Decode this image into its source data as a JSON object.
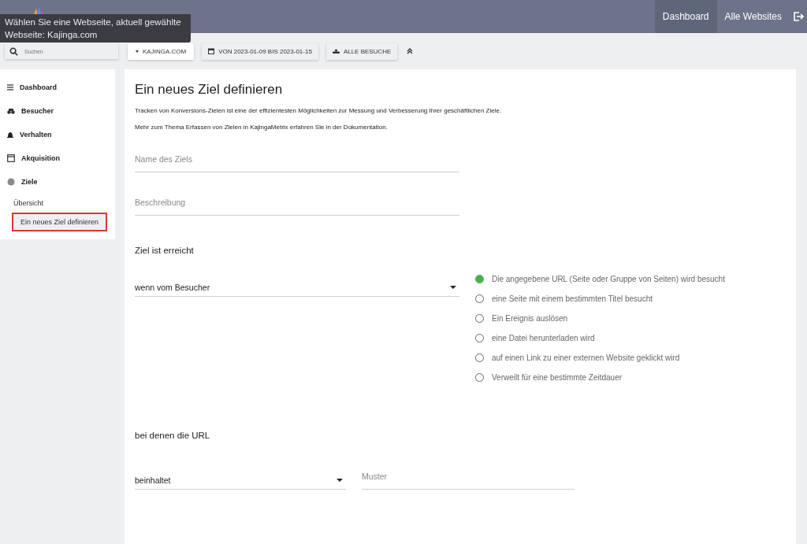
{
  "tooltip": "Wählen Sie eine Webseite, aktuell gewählte Webseite: Kajinga.com",
  "top_nav": [
    {
      "label": "Dashboard",
      "selected": true
    },
    {
      "label": "Alle Websites",
      "selected": false
    }
  ],
  "toolbar": {
    "search": {
      "placeholder": "Suchen"
    },
    "site_button": "KAJINGA.COM",
    "date_button": "VON 2023-01-09 BIS 2023-01-15",
    "segment_button": "ALLE BESUCHE"
  },
  "sidebar": {
    "items": [
      {
        "label": "Dashboard"
      },
      {
        "label": "Besucher"
      },
      {
        "label": "Verhalten"
      },
      {
        "label": "Akquisition"
      },
      {
        "label": "Ziele",
        "children": [
          {
            "label": "Übersicht",
            "selected": false
          },
          {
            "label": "Ein neues Ziel definieren",
            "selected": true
          }
        ]
      }
    ]
  },
  "page": {
    "title": "Ein neues Ziel definieren",
    "intro": "Tracken von Konversions-Zielen ist eine der effizientesten Möglichkeiten zur Messung und Verbesserung Ihrer geschäftlichen Ziele.",
    "doc_note": "Mehr zum Thema Erfassen von Zielen in KajingaMetrix erfahren Sie in der Dokumentation.",
    "name_field": {
      "placeholder": "Name des Ziels"
    },
    "description_field": {
      "placeholder": "Beschreibung"
    },
    "trigger_heading": "Ziel ist erreicht",
    "trigger_select": "wenn vom Besucher",
    "trigger_options": [
      {
        "label": "Die angegebene URL (Seite oder Gruppe von Seiten) wird besucht",
        "selected": true
      },
      {
        "label": "eine Seite mit einem bestimmten Titel besucht",
        "selected": false
      },
      {
        "label": "Ein Ereignis auslösen",
        "selected": false
      },
      {
        "label": "eine Datei herunterladen wird",
        "selected": false
      },
      {
        "label": "auf einen Link zu einer externen Website geklickt wird",
        "selected": false
      },
      {
        "label": "Verweilt für eine bestimmte Zeitdauer",
        "selected": false
      }
    ],
    "url_heading": "bei denen die URL",
    "match_select": "beinhaltet",
    "pattern_field": {
      "placeholder": "Muster"
    }
  }
}
